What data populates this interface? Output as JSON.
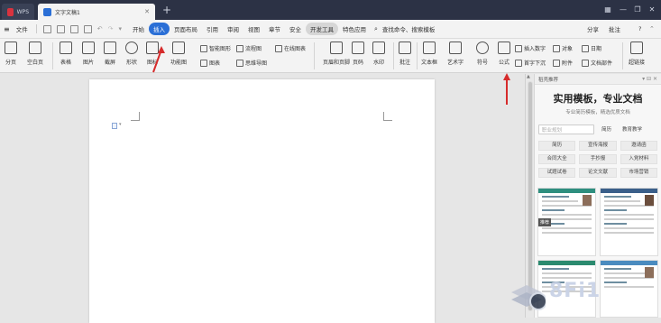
{
  "titlebar": {
    "tabs": [
      {
        "label": "WPS"
      },
      {
        "label": "文字文稿1"
      }
    ],
    "new_tab": "+"
  },
  "menubar": {
    "file_label": "文件",
    "items": [
      "开始",
      "插入",
      "页面布局",
      "引用",
      "审阅",
      "视图",
      "章节",
      "安全",
      "开发工具",
      "特色应用"
    ],
    "active_item": "插入",
    "search_label": "查找命令、搜索模板",
    "share_label": "分享",
    "comment_label": "批注",
    "help_label": "?"
  },
  "ribbon": {
    "buttons": [
      "分页",
      "空白页",
      "表格",
      "图片",
      "截屏",
      "形状",
      "图标",
      "功能图",
      "页眉和页脚",
      "页码",
      "水印",
      "批注",
      "文本框",
      "艺术字",
      "符号",
      "公式",
      "超链接"
    ],
    "small_items": [
      "智能图形",
      "图表",
      "流程图",
      "思维导图",
      "在线图表",
      "插入数字",
      "对象",
      "日期",
      "首字下沉",
      "附件",
      "文档部件"
    ]
  },
  "panel": {
    "header_label": "稻壳推荐",
    "title": "实用模板，专业文档",
    "subtitle": "专业简历模板，精选优质文档",
    "search_placeholder": "职业规划",
    "keywords": [
      "简历",
      "教育教学"
    ],
    "tags": [
      "简历",
      "宣传海报",
      "邀请函",
      "合同大全",
      "手抄报",
      "入党材料",
      "试题试卷",
      "论文文献",
      "市场营销"
    ],
    "badge": "推荐"
  },
  "watermark": {
    "text": "8Fi1"
  },
  "colors": {
    "titlebar": "#2c3245",
    "accent": "#2b6fd6",
    "annotation_arrow": "#d62b2b"
  }
}
